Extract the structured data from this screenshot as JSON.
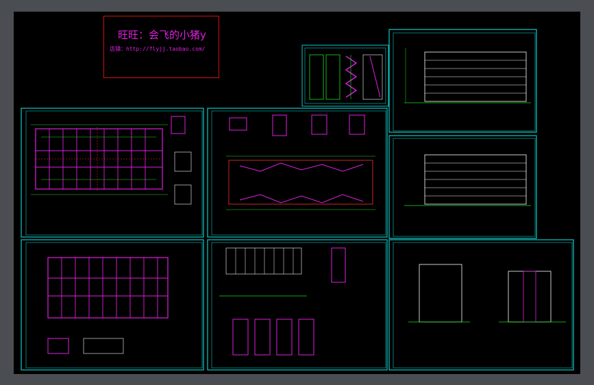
{
  "watermark": {
    "title": "旺旺：会飞的小猪y",
    "shop": "店铺：http://flyjj.taobao.com/"
  },
  "colors": {
    "workspace": "#000000",
    "frame": "#10c8c8",
    "wall": "#e020e0",
    "line": "#20e020",
    "axis": "#ff3030",
    "detail": "#ffffff",
    "watermark_border": "#d01010"
  },
  "sheets": [
    {
      "id": "detail-top",
      "kind": "detail"
    },
    {
      "id": "floor-plan-1",
      "kind": "plan"
    },
    {
      "id": "details-roof",
      "kind": "roof"
    },
    {
      "id": "elevation-front",
      "kind": "elevation"
    },
    {
      "id": "elevation-rear",
      "kind": "elevation"
    },
    {
      "id": "floor-plan-2",
      "kind": "plan"
    },
    {
      "id": "details-stair",
      "kind": "detail"
    },
    {
      "id": "elevation-side",
      "kind": "side"
    }
  ]
}
